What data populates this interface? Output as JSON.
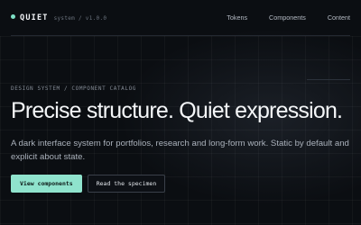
{
  "header": {
    "brand_name": "QUIET",
    "brand_meta": "system / v1.0.0",
    "nav": [
      "Tokens",
      "Components",
      "Content"
    ]
  },
  "hero": {
    "eyebrow": "DESIGN SYSTEM / COMPONENT CATALOG",
    "headline": "Precise structure. Quiet expression.",
    "lede": "A dark interface system for portfolios, research and long-form work. Static by default and explicit about state."
  },
  "actions": {
    "primary_label": "View components",
    "secondary_label": "Read the specimen"
  },
  "colors": {
    "background": "#0b0e12",
    "accent": "#8fe3cd",
    "text": "#f4f6f8",
    "muted": "#aab1bb"
  },
  "icons": {
    "brand": "status-dot-icon"
  }
}
